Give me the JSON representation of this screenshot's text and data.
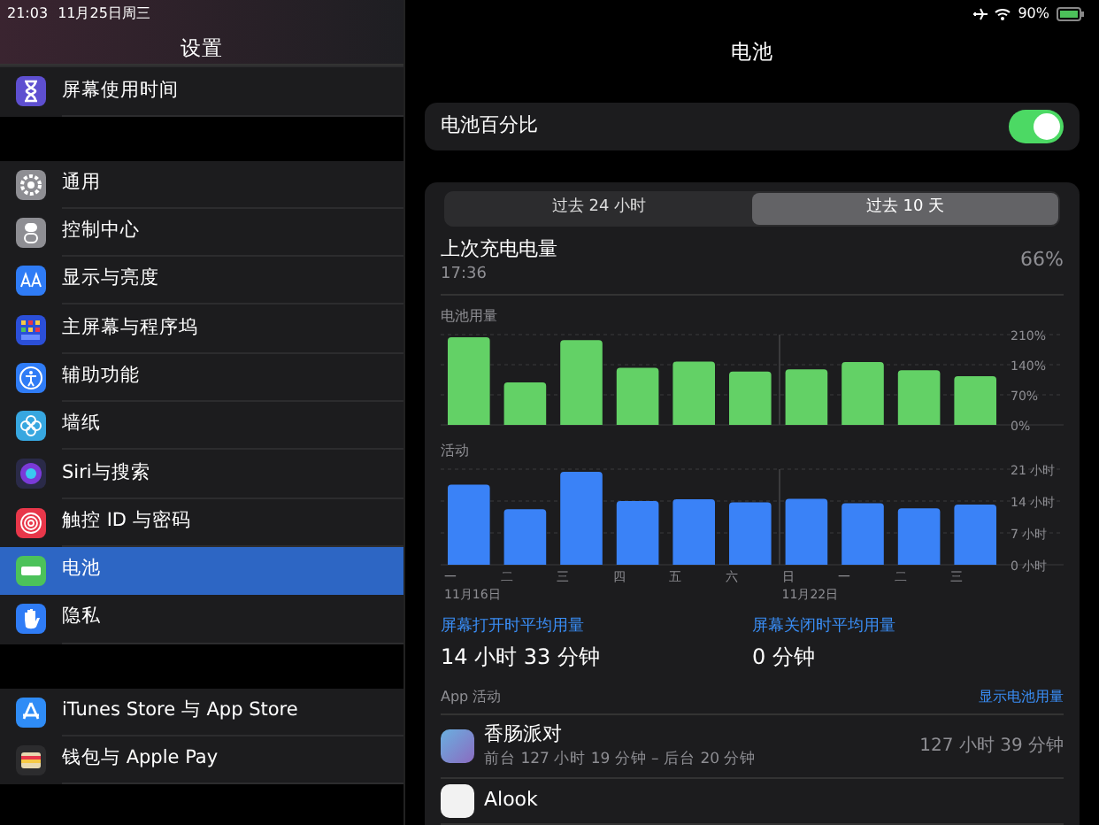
{
  "status_bar": {
    "time": "21:03",
    "date": "11月25日周三",
    "battery": "90%"
  },
  "sidebar": {
    "title": "设置",
    "groups": [
      [
        {
          "label": "屏幕使用时间",
          "color": "#5e4fd0",
          "selected": false
        }
      ],
      [
        {
          "label": "通用",
          "color": "#8e8e93",
          "selected": false
        },
        {
          "label": "控制中心",
          "color": "#8e8e93",
          "selected": false
        },
        {
          "label": "显示与亮度",
          "color": "#2f7cf6",
          "selected": false
        },
        {
          "label": "主屏幕与程序坞",
          "color": "#2b4fd8",
          "selected": false
        },
        {
          "label": "辅助功能",
          "color": "#2f7cf6",
          "selected": false
        },
        {
          "label": "墙纸",
          "color": "#37a7e0",
          "selected": false
        },
        {
          "label": "Siri与搜索",
          "color": "#2a2a48",
          "selected": false
        },
        {
          "label": "触控 ID 与密码",
          "color": "#e8374a",
          "selected": false
        },
        {
          "label": "电池",
          "color": "#4cc25a",
          "selected": true
        },
        {
          "label": "隐私",
          "color": "#2f7cf6",
          "selected": false
        }
      ],
      [
        {
          "label": "iTunes Store 与 App Store",
          "color": "#2f8cf6",
          "selected": false
        },
        {
          "label": "钱包与 Apple Pay",
          "color": "#2c2c2e",
          "selected": false
        }
      ]
    ]
  },
  "detail": {
    "title": "电池",
    "percentage_toggle": {
      "label": "电池百分比",
      "on": true
    },
    "tabs": [
      {
        "label": "过去 24 小时",
        "selected": false
      },
      {
        "label": "过去 10 天",
        "selected": true
      }
    ],
    "last_charge": {
      "label": "上次充电电量",
      "time": "17:36",
      "value": "66%"
    },
    "battery_chart": {
      "chart_data": {
        "type": "bar",
        "ylim": [
          0,
          210
        ],
        "yticks": [
          {
            "value": 0,
            "label": "0%"
          },
          {
            "value": 70,
            "label": "70%"
          },
          {
            "value": 140,
            "label": "140%"
          },
          {
            "value": 210,
            "label": "210%"
          }
        ],
        "series": [
          {
            "name": "电池用量",
            "color": "#63d166",
            "values": [
              204,
              99,
              197,
              133,
              147,
              124,
              129,
              146,
              127,
              113
            ]
          }
        ]
      }
    },
    "activity_chart": {
      "chart_data": {
        "type": "bar",
        "ylim": [
          0,
          21
        ],
        "categories": [
          "一",
          "二",
          "三",
          "四",
          "五",
          "六",
          "日",
          "一",
          "二",
          "三"
        ],
        "yticks": [
          {
            "value": 0,
            "label": "0 小时"
          },
          {
            "value": 7,
            "label": "7 小时"
          },
          {
            "value": 14,
            "label": "14 小时"
          },
          {
            "value": 21,
            "label": "21 小时"
          }
        ],
        "series": [
          {
            "name": "活动",
            "color": "#3a82f7",
            "values": [
              17.6,
              12.2,
              20.4,
              14,
              14.4,
              13.7,
              14.5,
              13.5,
              12.4,
              13.2
            ]
          }
        ]
      },
      "date_labels": [
        "11月16日",
        "11月22日"
      ]
    },
    "stats": [
      {
        "label": "屏幕打开时平均用量",
        "value": "14 小时 33 分钟"
      },
      {
        "label": "屏幕关闭时平均用量",
        "value": "0 分钟"
      }
    ],
    "app_activity": {
      "label": "App 活动",
      "link": "显示电池用量",
      "apps": [
        {
          "name": "香肠派对",
          "detail": "前台 127 小时 19 分钟 – 后台 20 分钟",
          "time": "127 小时 39 分钟"
        },
        {
          "name": "Alook"
        }
      ]
    }
  }
}
